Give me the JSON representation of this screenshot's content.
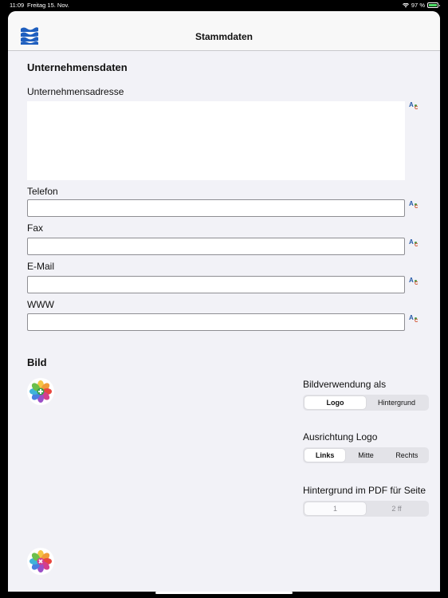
{
  "status_bar": {
    "time": "11:09",
    "date": "Freitag 15. Nov.",
    "battery_text": "97 %",
    "battery_level": 0.97
  },
  "nav": {
    "title": "Stammdaten",
    "logo_icon": "blue-waves-logo-icon"
  },
  "company": {
    "section_title": "Unternehmensdaten",
    "address_label": "Unternehmensadresse",
    "address_value": "",
    "phone_label": "Telefon",
    "phone_value": "",
    "fax_label": "Fax",
    "fax_value": "",
    "email_label": "E-Mail",
    "email_value": "",
    "www_label": "WWW",
    "www_value": ""
  },
  "image": {
    "section_title": "Bild",
    "add_icon": "photos-add-icon",
    "remove_icon": "photos-remove-icon"
  },
  "usage": {
    "label": "Bildverwendung als",
    "options": [
      "Logo",
      "Hintergrund"
    ],
    "selected": "Logo"
  },
  "alignment": {
    "label": "Ausrichtung Logo",
    "options": [
      "Links",
      "Mitte",
      "Rechts"
    ],
    "selected": "Links"
  },
  "background_pages": {
    "label": "Hintergrund im PDF für Seite",
    "options": [
      "1",
      "2 ff"
    ],
    "selected": "1",
    "enabled": false
  },
  "colors": {
    "accent": "#2458a6",
    "background": "#f2f2f7"
  }
}
